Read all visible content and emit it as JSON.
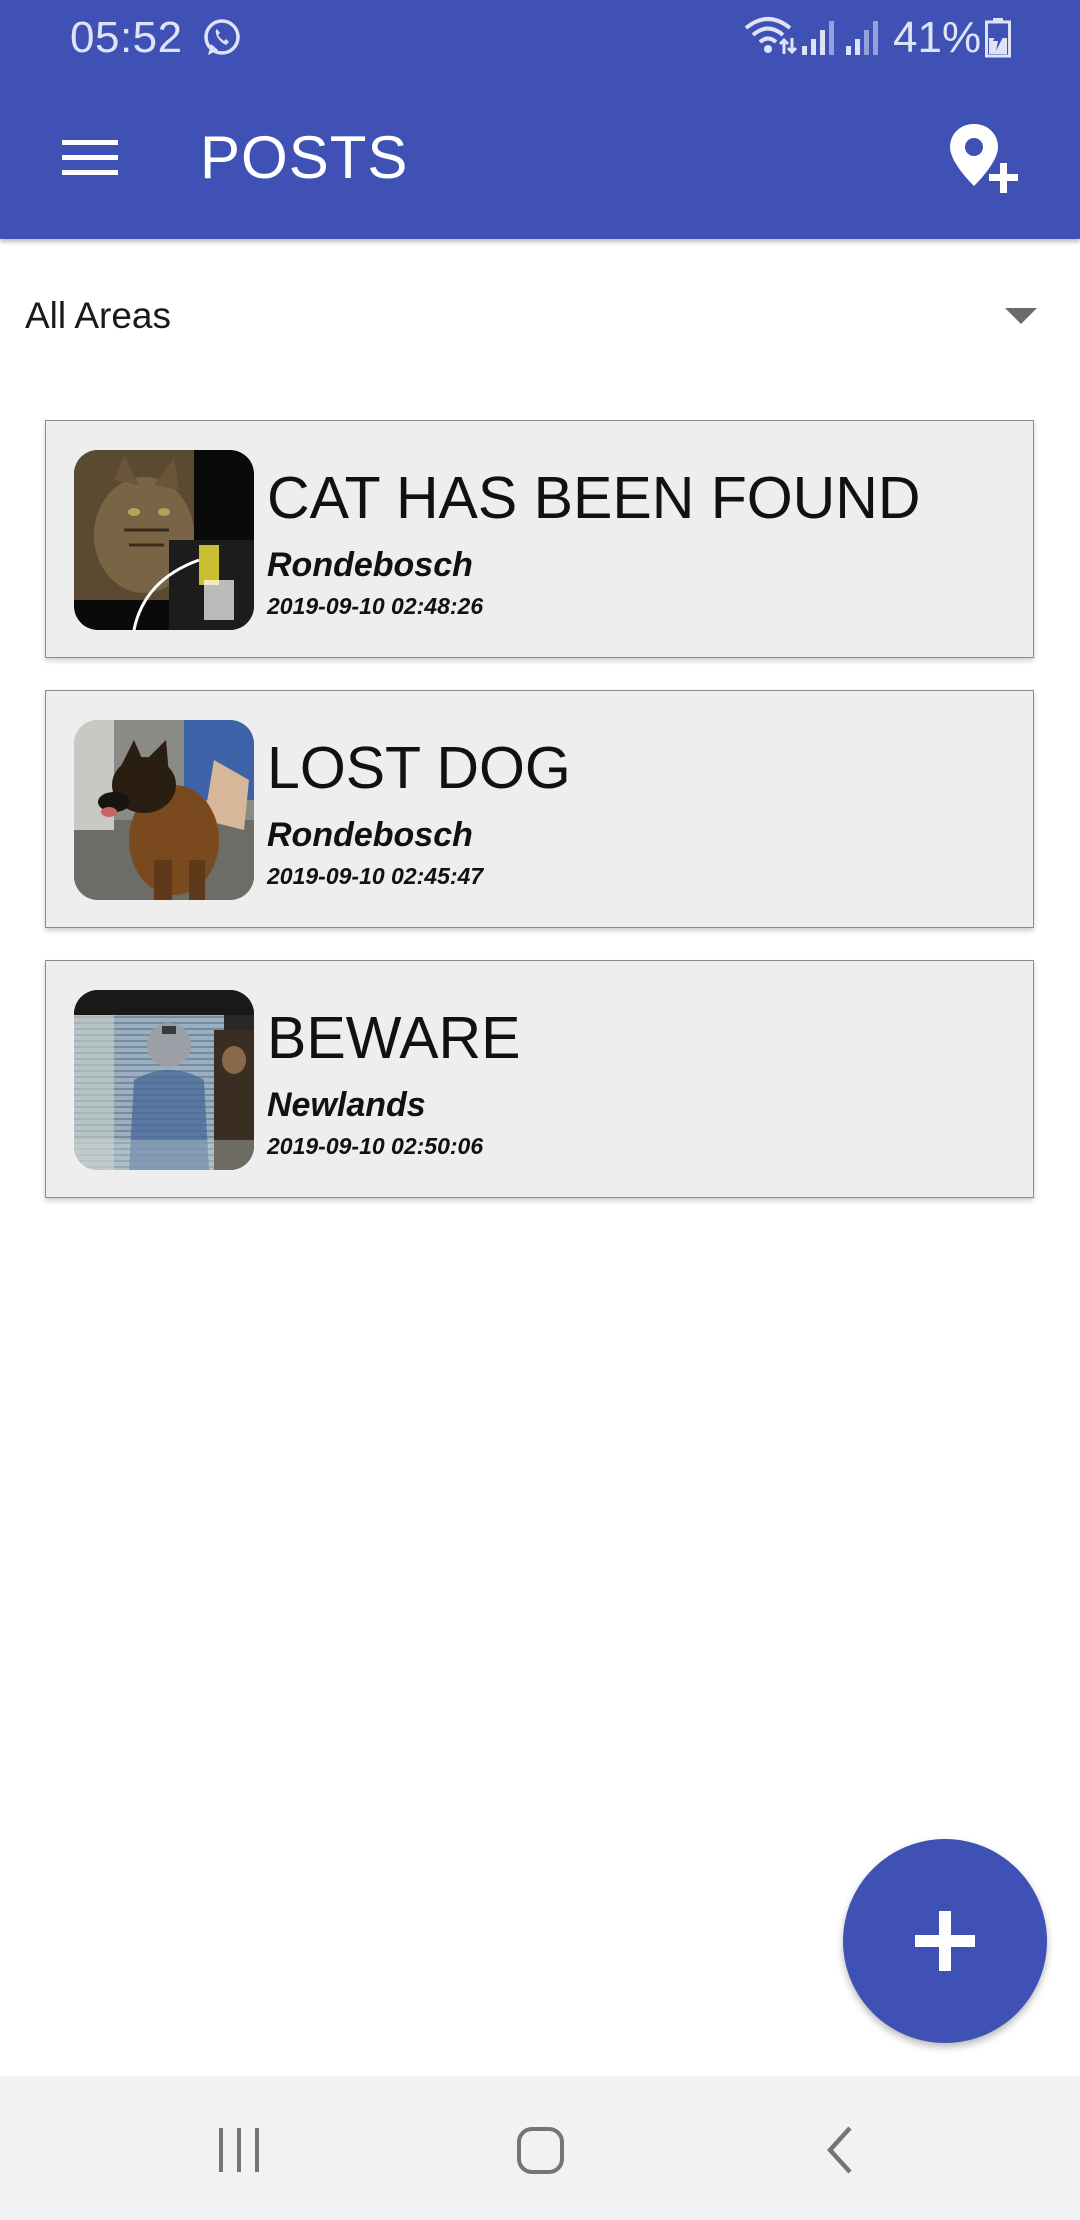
{
  "status_bar": {
    "time": "05:52",
    "battery": "41%",
    "icons": [
      "whatsapp-icon",
      "wifi-icon",
      "signal-icon",
      "signal-icon",
      "battery-charging-icon"
    ]
  },
  "app_bar": {
    "title": "POSTS",
    "menu_icon": "hamburger-menu-icon",
    "action_icon": "add-location-icon"
  },
  "filter": {
    "selected": "All Areas",
    "icon": "dropdown-arrow-icon"
  },
  "posts": [
    {
      "title": "CAT HAS BEEN FOUND",
      "area": "Rondebosch",
      "date": "2019-09-10 02:48:26"
    },
    {
      "title": "LOST DOG",
      "area": "Rondebosch",
      "date": "2019-09-10 02:45:47"
    },
    {
      "title": "BEWARE",
      "area": "Newlands",
      "date": "2019-09-10 02:50:06"
    }
  ],
  "fab": {
    "icon": "plus-icon"
  },
  "nav_bar": {
    "icons": [
      "recents-icon",
      "home-icon",
      "back-icon"
    ]
  },
  "colors": {
    "primary": "#3f51b5",
    "card_background": "#eeeeee",
    "nav_bar_background": "#f2f2f2"
  }
}
